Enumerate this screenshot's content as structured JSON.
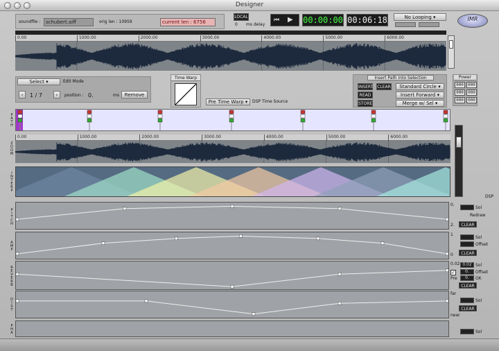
{
  "window": {
    "title": "Designer"
  },
  "header": {
    "soundfile_label": "soundfile :",
    "soundfile_value": "schubert.aiff",
    "orig_len": "orig len : 10959",
    "current_len": "current len : 6756",
    "local_button": "LOCAL",
    "delay_value": "0",
    "delay_label": "ms delay",
    "transport_time": "00:00:00",
    "total_time": "00:06:18",
    "looping": "No Looping",
    "logo": "IMR"
  },
  "ruler_ticks": [
    "0.00",
    "1000.00",
    "2000.00",
    "3000.00",
    "4000.00",
    "5000.00",
    "6000.00"
  ],
  "zoom_ticks": [
    "0.00",
    "1000.00",
    "2000.00",
    "3000.00",
    "4000.00",
    "5000.00",
    "6000.00"
  ],
  "edit": {
    "mode_select": "Select",
    "mode_label": "Edit Mode",
    "counter": "1 / 7",
    "position_label": "position :",
    "position_value": "0.",
    "ms_label": "ms",
    "remove": "Remove"
  },
  "timewarp": {
    "title": "Time Warp",
    "pre_select": "Pre Time Warp",
    "dsp_source": "DSP Time Source"
  },
  "insert_path": {
    "title": "Insert Path Into Selection",
    "insert": "INSERT",
    "clear": "CLEAR",
    "read": "READ",
    "store": "STORE",
    "shape": "Standard Circle",
    "direction": "Insert Forward",
    "merge": "Merge w/ Sel"
  },
  "power": {
    "title": "Power",
    "values": [
      "000",
      "000",
      "000",
      "000",
      "000",
      "000"
    ]
  },
  "tracks": {
    "path": "PATH",
    "zoom": "ZOOM",
    "interp": "INTERP",
    "pitch": "PITCH",
    "amp": "AMP",
    "reverb": "REVERB",
    "dist": "DIST",
    "pha": "PHA"
  },
  "dsp_label": "DSP",
  "pitch_ctl": {
    "top": "0.",
    "sol": "Sol",
    "redraw": "Redraw",
    "bottom": "2.",
    "clear": "CLEAR"
  },
  "amp_ctl": {
    "top": "1",
    "sol": "Sol",
    "offset": "Offset",
    "bottom": "0",
    "clear": "CLEAR"
  },
  "reverb_ctl": {
    "top": "0.02",
    "val": "0.02",
    "sol": "Sol",
    "val2": "0.",
    "offset": "Offset",
    "prefix": "Pre",
    "val3": "0.",
    "ok": "OK",
    "clear": "CLEAR"
  },
  "dist_ctl": {
    "top": "far",
    "sol": "Sol",
    "clear": "CLEAR",
    "bottom": "near"
  },
  "pha_ctl": {
    "sol": "Sol"
  },
  "envelopes": {
    "pitch": [
      [
        0,
        0.65
      ],
      [
        0.25,
        0.2
      ],
      [
        0.5,
        0.1
      ],
      [
        0.75,
        0.2
      ],
      [
        1,
        0.65
      ]
    ],
    "amp": [
      [
        0,
        0.85
      ],
      [
        0.2,
        0.4
      ],
      [
        0.37,
        0.2
      ],
      [
        0.52,
        0.1
      ],
      [
        0.7,
        0.2
      ],
      [
        0.85,
        0.4
      ],
      [
        1,
        0.85
      ]
    ],
    "reverb": [
      [
        0,
        0.45
      ],
      [
        0.5,
        0.95
      ],
      [
        0.75,
        0.45
      ],
      [
        1,
        0.3
      ]
    ],
    "dist": [
      [
        0,
        0.35
      ],
      [
        0.3,
        0.35
      ],
      [
        0.55,
        0.9
      ],
      [
        0.75,
        0.45
      ],
      [
        1,
        0.35
      ]
    ]
  }
}
